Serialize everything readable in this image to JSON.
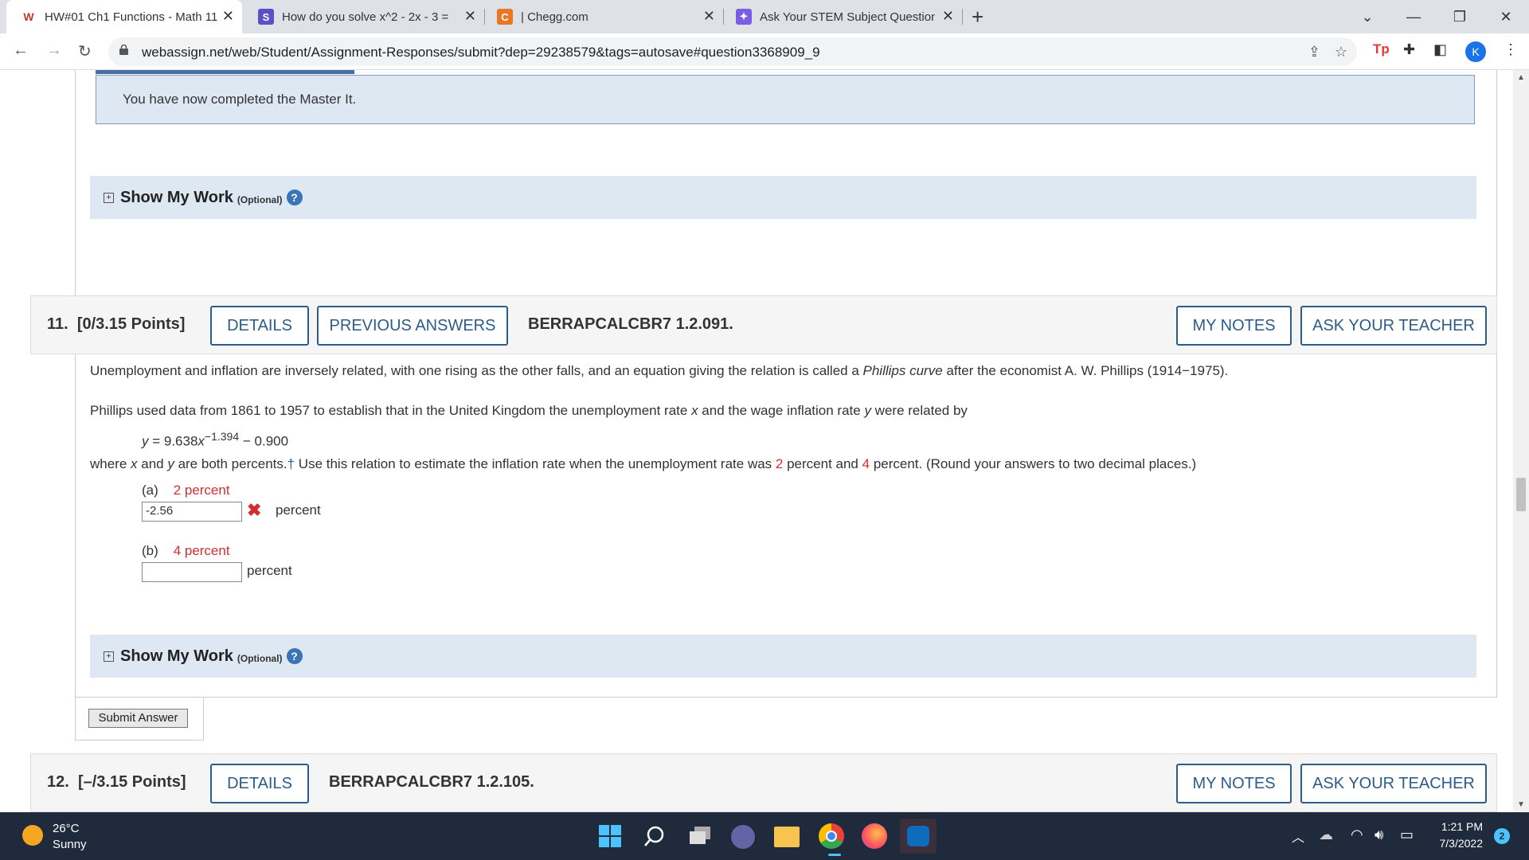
{
  "browser": {
    "tabs": [
      {
        "title": "HW#01 Ch1 Functions - Math 11",
        "icon": "webassign-icon"
      },
      {
        "title": "How do you solve x^2 - 2x - 3 =",
        "icon": "socratic-icon"
      },
      {
        "title": "| Chegg.com",
        "icon": "chegg-icon"
      },
      {
        "title": "Ask Your STEM Subject Question",
        "icon": "ai-icon"
      }
    ],
    "new_tab": "+",
    "url": "webassign.net/web/Student/Assignment-Responses/submit?dep=29238579&tags=autosave#question3368909_9",
    "profile_letter": "K"
  },
  "prev_question": {
    "master_message": "You have now completed the Master It.",
    "show_my_work": "Show My Work",
    "optional": "(Optional)"
  },
  "question11": {
    "number": "11.",
    "points": "[0/3.15 Points]",
    "details": "DETAILS",
    "previous_answers": "PREVIOUS ANSWERS",
    "code": "BERRAPCALCBR7 1.2.091.",
    "my_notes": "MY NOTES",
    "ask_teacher": "ASK YOUR TEACHER",
    "para1_a": "Unemployment and inflation are inversely related, with one rising as the other falls, and an equation giving the relation is called a ",
    "para1_italic": "Phillips curve",
    "para1_b": " after the economist A. W. Phillips (1914−1975).",
    "para2_a": "Phillips used data from 1861 to 1957 to establish that in the United Kingdom the unemployment rate ",
    "var_x": "x",
    "para2_b": " and the wage inflation rate ",
    "var_y": "y",
    "para2_c": " were related by",
    "eq_lhs": "y",
    "eq_mid": " = 9.638",
    "eq_x": "x",
    "eq_exp": "−1.394",
    "eq_rhs": " − 0.900",
    "para3_a": "where ",
    "para3_b": " and ",
    "para3_c": " are both percents.",
    "dagger": "†",
    "para3_d": " Use this relation to estimate the inflation rate when the unemployment rate was ",
    "val2": "2",
    "para3_e": " percent and ",
    "val4": "4",
    "para3_f": " percent. (Round your answers to two decimal places.)",
    "part_a_label": "(a)",
    "part_a_value": "2 percent",
    "part_a_answer": "-2.56",
    "part_a_unit": "percent",
    "part_b_label": "(b)",
    "part_b_value": "4 percent",
    "part_b_answer": "",
    "part_b_unit": "percent",
    "show_my_work": "Show My Work",
    "optional": "(Optional)",
    "submit": "Submit Answer"
  },
  "question12": {
    "number": "12.",
    "points": "[–/3.15 Points]",
    "details": "DETAILS",
    "code": "BERRAPCALCBR7 1.2.105.",
    "my_notes": "MY NOTES",
    "ask_teacher": "ASK YOUR TEACHER"
  },
  "taskbar": {
    "temperature": "26°C",
    "weather": "Sunny",
    "time": "1:21 PM",
    "date": "7/3/2022",
    "notifications": "2"
  }
}
